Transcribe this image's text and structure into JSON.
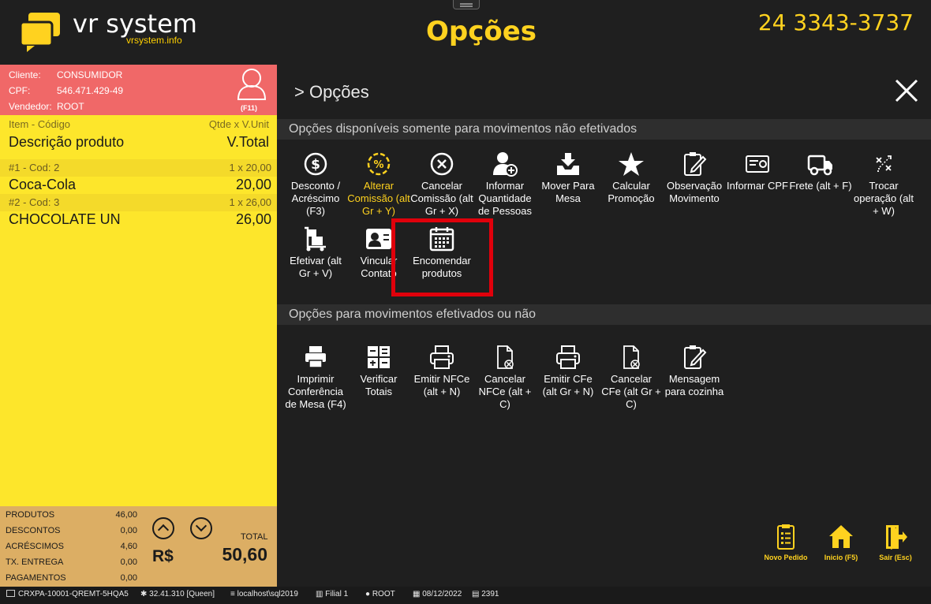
{
  "header": {
    "brand_name": "vr system",
    "brand_url": "vrsystem.info",
    "title": "Opções",
    "phone": "24 3343-3737"
  },
  "customer": {
    "client_label": "Cliente:",
    "client_value": "CONSUMIDOR",
    "cpf_label": "CPF:",
    "cpf_value": "546.471.429-49",
    "seller_label": "Vendedor:",
    "seller_value": "ROOT",
    "shortcut": "(F11)"
  },
  "items_header": {
    "col1": "Item - Código",
    "col2": "Qtde x V.Unit",
    "col3": "Descrição produto",
    "col4": "V.Total"
  },
  "items": [
    {
      "code": "#1 - Cod: 2",
      "qty": "1 x 20,00",
      "desc": "Coca-Cola",
      "total": "20,00"
    },
    {
      "code": "#2 - Cod: 3",
      "qty": "1 x 26,00",
      "desc": "CHOCOLATE UN",
      "total": "26,00"
    }
  ],
  "totals": {
    "rows": [
      {
        "label": "PRODUTOS",
        "value": "46,00"
      },
      {
        "label": "DESCONTOS",
        "value": "0,00"
      },
      {
        "label": "ACRÉSCIMOS",
        "value": "4,60"
      },
      {
        "label": "TX. ENTREGA",
        "value": "0,00"
      },
      {
        "label": "PAGAMENTOS",
        "value": "0,00"
      }
    ],
    "currency": "R$",
    "total_label": "TOTAL",
    "total_value": "50,60"
  },
  "panel": {
    "breadcrumb": "> Opções",
    "section1": "Opções disponíveis somente para movimentos não efetivados",
    "section2": "Opções para movimentos efetivados ou não"
  },
  "options1": [
    {
      "icon": "dollar-circle-icon",
      "label": "Desconto / Acréscimo (F3)"
    },
    {
      "icon": "percent-circle-icon",
      "label": "Alterar Comissão (alt Gr + Y)",
      "color": "#ffd21f"
    },
    {
      "icon": "x-circle-icon",
      "label": "Cancelar Comissão (alt Gr + X)"
    },
    {
      "icon": "add-person-icon",
      "label": "Informar Quantidade de Pessoas"
    },
    {
      "icon": "tray-download-icon",
      "label": "Mover Para Mesa"
    },
    {
      "icon": "star-icon",
      "label": "Calcular Promoção"
    },
    {
      "icon": "clipboard-pen-icon",
      "label": "Observação Movimento"
    },
    {
      "icon": "id-card-icon",
      "label": "Informar CPF"
    },
    {
      "icon": "truck-icon",
      "label": "Frete (alt + F)"
    },
    {
      "icon": "swap-arrows-icon",
      "label": "Trocar operação (alt + W)"
    },
    {
      "icon": "dolly-boxes-icon",
      "label": "Efetivar (alt Gr + V)"
    },
    {
      "icon": "contact-card-icon",
      "label": "Vincular Contato"
    },
    {
      "icon": "calendar-icon",
      "label": "Encomendar produtos"
    }
  ],
  "options2": [
    {
      "icon": "printer-icon",
      "label": "Imprimir Conferência de Mesa (F4)"
    },
    {
      "icon": "calculator-icon",
      "label": "Verificar Totais"
    },
    {
      "icon": "printer-icon",
      "label": "Emitir NFCe (alt + N)"
    },
    {
      "icon": "file-cancel-icon",
      "label": "Cancelar NFCe (alt + C)"
    },
    {
      "icon": "printer-icon",
      "label": "Emitir CFe (alt Gr + N)"
    },
    {
      "icon": "file-cancel-icon",
      "label": "Cancelar CFe (alt Gr + C)"
    },
    {
      "icon": "clipboard-pen-icon",
      "label": "Mensagem para cozinha"
    }
  ],
  "bottom_buttons": [
    {
      "icon": "order-list-icon",
      "label": "Novo Pedido"
    },
    {
      "icon": "home-icon",
      "label": "Inicio (F5)"
    },
    {
      "icon": "exit-door-icon",
      "label": "Sair (Esc)"
    }
  ],
  "statusbar": {
    "terminal": "CRXPA-10001-QREMT-5HQA5",
    "version": "32.41.310 [Queen]",
    "database": "localhost\\sql2019",
    "branch": "Filial 1",
    "user": "ROOT",
    "date": "08/12/2022",
    "number": "2391"
  }
}
